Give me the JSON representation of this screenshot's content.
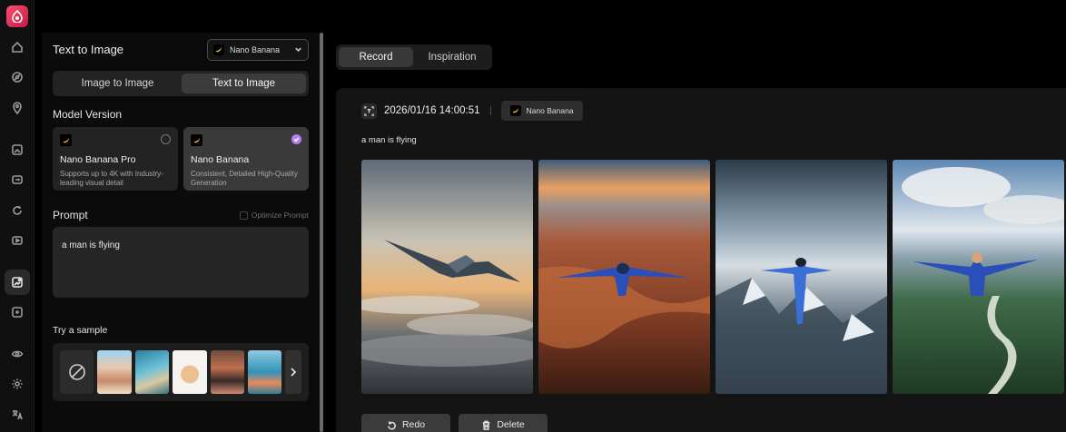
{
  "panel": {
    "title": "Text to Image",
    "model_select": "Nano Banana",
    "modes": [
      {
        "label": "Image to Image",
        "selected": false
      },
      {
        "label": "Text to Image",
        "selected": true
      }
    ],
    "model_version_label": "Model Version",
    "models": [
      {
        "title": "Nano Banana Pro",
        "desc": "Supports up to 4K with Industry-leading visual detail",
        "selected": false
      },
      {
        "title": "Nano Banana",
        "desc": "Consistent, Detailed High-Quality Generation",
        "selected": true
      }
    ],
    "prompt_label": "Prompt",
    "optimize_label": "Optimize Prompt",
    "prompt_value": "a man is flying",
    "sample_label": "Try a sample"
  },
  "main": {
    "tabs": [
      {
        "label": "Record",
        "selected": true
      },
      {
        "label": "Inspiration",
        "selected": false
      }
    ],
    "record": {
      "timestamp": "2026/01/16 14:00:51",
      "model_chip": "Nano Banana",
      "prompt": "a man is flying",
      "actions": {
        "redo": "Redo",
        "delete": "Delete"
      }
    }
  },
  "colors": {
    "accent_check": "#b47cf5",
    "brand": "#e0224f"
  }
}
